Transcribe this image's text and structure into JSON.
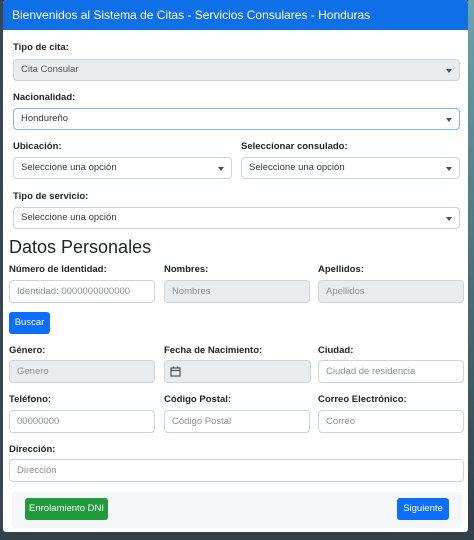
{
  "title": "Bienvenidos al Sistema de Citas - Servicios Consulares - Honduras",
  "tipo_cita": {
    "label": "Tipo de cita:",
    "value": "Cita Consular"
  },
  "nacionalidad": {
    "label": "Nacionalidad:",
    "value": "Hondureño"
  },
  "ubicacion": {
    "label": "Ubicación:",
    "value": "Seleccione una opción"
  },
  "consulado": {
    "label": "Seleccionar consulado:",
    "value": "Seleccione una opción"
  },
  "tipo_servicio": {
    "label": "Tipo de servicio:",
    "value": "Seleccione una opción"
  },
  "section_title": "Datos Personales",
  "identidad": {
    "label": "Número de Identidad:",
    "placeholder": "Identidad: 0000000000000"
  },
  "nombres": {
    "label": "Nombres:",
    "placeholder": "Nombres"
  },
  "apellidos": {
    "label": "Apellidos:",
    "placeholder": "Apellidos"
  },
  "buscar_button": "Buscar",
  "genero": {
    "label": "Género:",
    "placeholder": "Genero"
  },
  "fecha_nacimiento": {
    "label": "Fecha de Nacimiento:"
  },
  "ciudad": {
    "label": "Ciudad:",
    "placeholder": "Ciudad de residencia"
  },
  "telefono": {
    "label": "Teléfono:",
    "placeholder": "00000000"
  },
  "codigo_postal": {
    "label": "Código Postal:",
    "placeholder": "Código Postal"
  },
  "correo": {
    "label": "Correo Electrónico:",
    "placeholder": "Correo"
  },
  "direccion": {
    "label": "Dirección:",
    "placeholder": "Dirección"
  },
  "footer": {
    "enrolamiento_button": "Enrolamiento DNI",
    "siguiente_button": "Siguiente"
  },
  "colors": {
    "header": "#0e6fe6",
    "primary": "#0d6efd",
    "success": "#1f9a3c"
  }
}
